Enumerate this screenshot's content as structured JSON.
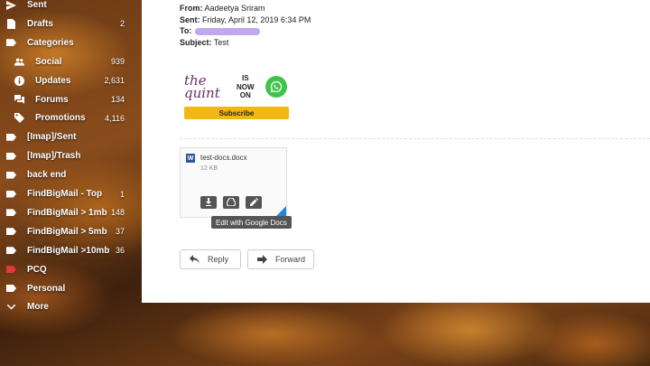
{
  "sidebar": {
    "items": [
      {
        "label": "Sent",
        "count": "",
        "icon": "sent-icon",
        "sub": false
      },
      {
        "label": "Drafts",
        "count": "2",
        "icon": "drafts-icon",
        "sub": false
      },
      {
        "label": "Categories",
        "count": "",
        "icon": "categories-icon",
        "sub": false
      },
      {
        "label": "Social",
        "count": "939",
        "icon": "social-icon",
        "sub": true
      },
      {
        "label": "Updates",
        "count": "2,631",
        "icon": "updates-icon",
        "sub": true
      },
      {
        "label": "Forums",
        "count": "134",
        "icon": "forums-icon",
        "sub": true
      },
      {
        "label": "Promotions",
        "count": "4,116",
        "icon": "promotions-icon",
        "sub": true
      },
      {
        "label": "[Imap]/Sent",
        "count": "",
        "icon": "label-icon",
        "sub": false
      },
      {
        "label": "[Imap]/Trash",
        "count": "",
        "icon": "label-icon",
        "sub": false
      },
      {
        "label": "back end",
        "count": "",
        "icon": "label-icon",
        "sub": false
      },
      {
        "label": "FindBigMail - Top",
        "count": "1",
        "icon": "label-icon",
        "sub": false
      },
      {
        "label": "FindBigMail > 1mb",
        "count": "148",
        "icon": "label-icon",
        "sub": false
      },
      {
        "label": "FindBigMail > 5mb",
        "count": "37",
        "icon": "label-icon",
        "sub": false
      },
      {
        "label": "FindBigMail >10mb",
        "count": "36",
        "icon": "label-icon",
        "sub": false
      },
      {
        "label": "PCQ",
        "count": "",
        "icon": "label-icon-red",
        "sub": false
      },
      {
        "label": "Personal",
        "count": "",
        "icon": "label-icon",
        "sub": false
      },
      {
        "label": "More",
        "count": "",
        "icon": "chevron-down-icon",
        "sub": false
      }
    ]
  },
  "email": {
    "from_key": "From:",
    "from_val": "Aadeetya Sriram",
    "sent_key": "Sent:",
    "sent_val": "Friday, April 12, 2019 6:34 PM",
    "to_key": "To:",
    "subject_key": "Subject:",
    "subject_val": "Test"
  },
  "promo": {
    "brand_line1": "the",
    "brand_line2": "quint",
    "now_on_1": "IS",
    "now_on_2": "NOW",
    "now_on_3": "ON",
    "subscribe": "Subscribe"
  },
  "attachment": {
    "icon_letter": "W",
    "name": "test-docs.docx",
    "size": "12 KB",
    "tooltip": "Edit with Google Docs"
  },
  "actions": {
    "reply": "Reply",
    "forward": "Forward"
  },
  "colors": {
    "accent_subscribe": "#f3b712",
    "whatsapp": "#3fc34a",
    "word_blue": "#2b579a",
    "label_red": "#e53935"
  }
}
